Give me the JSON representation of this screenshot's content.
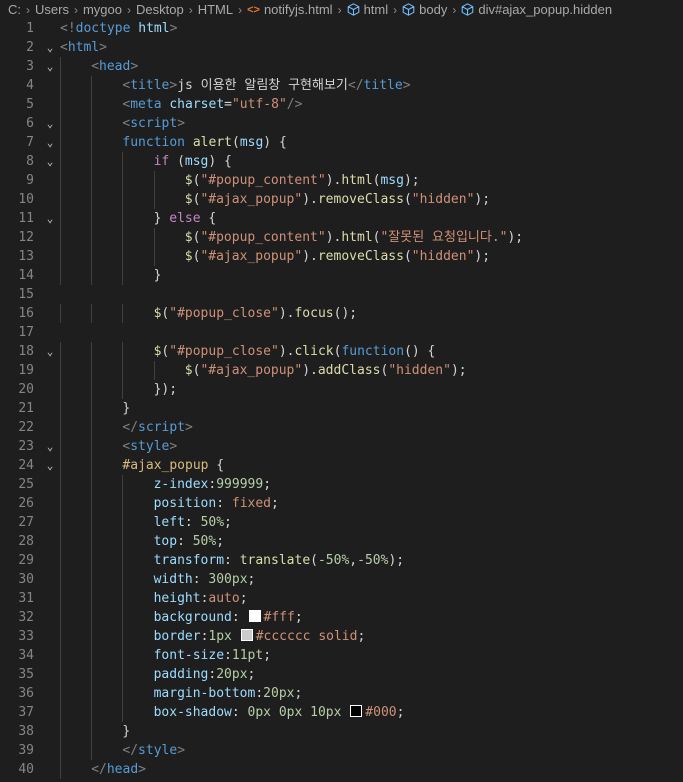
{
  "breadcrumb": [
    {
      "label": "C:",
      "icon": null
    },
    {
      "label": "Users",
      "icon": null
    },
    {
      "label": "mygoo",
      "icon": null
    },
    {
      "label": "Desktop",
      "icon": null
    },
    {
      "label": "HTML",
      "icon": null
    },
    {
      "label": "notifyjs.html",
      "icon": "html-file-icon"
    },
    {
      "label": "html",
      "icon": "element-cube-icon"
    },
    {
      "label": "body",
      "icon": "element-cube-icon"
    },
    {
      "label": "div#ajax_popup.hidden",
      "icon": "element-cube-icon"
    }
  ],
  "colors": {
    "background": "#1e1e1e",
    "line_number": "#858585",
    "tag": "#569cd6",
    "attribute": "#9cdcfe",
    "string": "#ce9178",
    "function": "#dcdcaa",
    "control": "#c586c0",
    "selector": "#d7ba7d",
    "number": "#b5cea8"
  },
  "lines": [
    {
      "n": "1",
      "indent": 0,
      "fold": "",
      "tokens": [
        [
          "punc",
          "<!"
        ],
        [
          "tag",
          "doctype"
        ],
        [
          "txt",
          " "
        ],
        [
          "attr",
          "html"
        ],
        [
          "punc",
          ">"
        ]
      ]
    },
    {
      "n": "2",
      "indent": 0,
      "fold": "v",
      "tokens": [
        [
          "punc",
          "<"
        ],
        [
          "tag",
          "html"
        ],
        [
          "punc",
          ">"
        ]
      ]
    },
    {
      "n": "3",
      "indent": 1,
      "fold": "v",
      "tokens": [
        [
          "punc",
          "<"
        ],
        [
          "tag",
          "head"
        ],
        [
          "punc",
          ">"
        ]
      ]
    },
    {
      "n": "4",
      "indent": 2,
      "fold": "",
      "tokens": [
        [
          "punc",
          "<"
        ],
        [
          "tag",
          "title"
        ],
        [
          "punc",
          ">"
        ],
        [
          "txt",
          "js 이용한 알림창 구현해보기"
        ],
        [
          "punc",
          "</"
        ],
        [
          "tag",
          "title"
        ],
        [
          "punc",
          ">"
        ]
      ]
    },
    {
      "n": "5",
      "indent": 2,
      "fold": "",
      "tokens": [
        [
          "punc",
          "<"
        ],
        [
          "tag",
          "meta"
        ],
        [
          "txt",
          " "
        ],
        [
          "attr",
          "charset"
        ],
        [
          "txt",
          "="
        ],
        [
          "str",
          "\"utf-8\""
        ],
        [
          "punc",
          "/>"
        ]
      ]
    },
    {
      "n": "6",
      "indent": 2,
      "fold": "v",
      "tokens": [
        [
          "punc",
          "<"
        ],
        [
          "tag",
          "script"
        ],
        [
          "punc",
          ">"
        ]
      ]
    },
    {
      "n": "7",
      "indent": 2,
      "fold": "v",
      "tokens": [
        [
          "kw",
          "function"
        ],
        [
          "txt",
          " "
        ],
        [
          "fn",
          "alert"
        ],
        [
          "txt",
          "("
        ],
        [
          "var",
          "msg"
        ],
        [
          "txt",
          ") {"
        ]
      ]
    },
    {
      "n": "8",
      "indent": 3,
      "fold": "v",
      "tokens": [
        [
          "ctl",
          "if"
        ],
        [
          "txt",
          " ("
        ],
        [
          "var",
          "msg"
        ],
        [
          "txt",
          ") {"
        ]
      ]
    },
    {
      "n": "9",
      "indent": 4,
      "fold": "",
      "tokens": [
        [
          "fn",
          "$"
        ],
        [
          "txt",
          "("
        ],
        [
          "str",
          "\"#popup_content\""
        ],
        [
          "txt",
          ")."
        ],
        [
          "fn",
          "html"
        ],
        [
          "txt",
          "("
        ],
        [
          "var",
          "msg"
        ],
        [
          "txt",
          ");"
        ]
      ]
    },
    {
      "n": "10",
      "indent": 4,
      "fold": "",
      "tokens": [
        [
          "fn",
          "$"
        ],
        [
          "txt",
          "("
        ],
        [
          "str",
          "\"#ajax_popup\""
        ],
        [
          "txt",
          ")."
        ],
        [
          "fn",
          "removeClass"
        ],
        [
          "txt",
          "("
        ],
        [
          "str",
          "\"hidden\""
        ],
        [
          "txt",
          ");"
        ]
      ]
    },
    {
      "n": "11",
      "indent": 3,
      "fold": "v",
      "tokens": [
        [
          "txt",
          "} "
        ],
        [
          "ctl",
          "else"
        ],
        [
          "txt",
          " {"
        ]
      ]
    },
    {
      "n": "12",
      "indent": 4,
      "fold": "",
      "tokens": [
        [
          "fn",
          "$"
        ],
        [
          "txt",
          "("
        ],
        [
          "str",
          "\"#popup_content\""
        ],
        [
          "txt",
          ")."
        ],
        [
          "fn",
          "html"
        ],
        [
          "txt",
          "("
        ],
        [
          "str",
          "\"잘못된 요청입니다.\""
        ],
        [
          "txt",
          ");"
        ]
      ]
    },
    {
      "n": "13",
      "indent": 4,
      "fold": "",
      "tokens": [
        [
          "fn",
          "$"
        ],
        [
          "txt",
          "("
        ],
        [
          "str",
          "\"#ajax_popup\""
        ],
        [
          "txt",
          ")."
        ],
        [
          "fn",
          "removeClass"
        ],
        [
          "txt",
          "("
        ],
        [
          "str",
          "\"hidden\""
        ],
        [
          "txt",
          ");"
        ]
      ]
    },
    {
      "n": "14",
      "indent": 3,
      "fold": "",
      "tokens": [
        [
          "txt",
          "}"
        ]
      ]
    },
    {
      "n": "15",
      "indent": 0,
      "fold": "",
      "tokens": []
    },
    {
      "n": "16",
      "indent": 3,
      "fold": "",
      "tokens": [
        [
          "fn",
          "$"
        ],
        [
          "txt",
          "("
        ],
        [
          "str",
          "\"#popup_close\""
        ],
        [
          "txt",
          ")."
        ],
        [
          "fn",
          "focus"
        ],
        [
          "txt",
          "();"
        ]
      ]
    },
    {
      "n": "17",
      "indent": 0,
      "fold": "",
      "tokens": []
    },
    {
      "n": "18",
      "indent": 3,
      "fold": "v",
      "tokens": [
        [
          "fn",
          "$"
        ],
        [
          "txt",
          "("
        ],
        [
          "str",
          "\"#popup_close\""
        ],
        [
          "txt",
          ")."
        ],
        [
          "fn",
          "click"
        ],
        [
          "txt",
          "("
        ],
        [
          "kw",
          "function"
        ],
        [
          "txt",
          "() {"
        ]
      ]
    },
    {
      "n": "19",
      "indent": 4,
      "fold": "",
      "tokens": [
        [
          "fn",
          "$"
        ],
        [
          "txt",
          "("
        ],
        [
          "str",
          "\"#ajax_popup\""
        ],
        [
          "txt",
          ")."
        ],
        [
          "fn",
          "addClass"
        ],
        [
          "txt",
          "("
        ],
        [
          "str",
          "\"hidden\""
        ],
        [
          "txt",
          ");"
        ]
      ]
    },
    {
      "n": "20",
      "indent": 3,
      "fold": "",
      "tokens": [
        [
          "txt",
          "});"
        ]
      ]
    },
    {
      "n": "21",
      "indent": 2,
      "fold": "",
      "tokens": [
        [
          "txt",
          "}"
        ]
      ]
    },
    {
      "n": "22",
      "indent": 2,
      "fold": "",
      "tokens": [
        [
          "punc",
          "</"
        ],
        [
          "tag",
          "script"
        ],
        [
          "punc",
          ">"
        ]
      ]
    },
    {
      "n": "23",
      "indent": 2,
      "fold": "v",
      "tokens": [
        [
          "punc",
          "<"
        ],
        [
          "tag",
          "style"
        ],
        [
          "punc",
          ">"
        ]
      ]
    },
    {
      "n": "24",
      "indent": 2,
      "fold": "v",
      "tokens": [
        [
          "sel",
          "#ajax_popup"
        ],
        [
          "txt",
          " {"
        ]
      ]
    },
    {
      "n": "25",
      "indent": 3,
      "fold": "",
      "tokens": [
        [
          "prop",
          "z-index"
        ],
        [
          "txt",
          ":"
        ],
        [
          "num",
          "999999"
        ],
        [
          "txt",
          ";"
        ]
      ]
    },
    {
      "n": "26",
      "indent": 3,
      "fold": "",
      "tokens": [
        [
          "prop",
          "position"
        ],
        [
          "txt",
          ": "
        ],
        [
          "val",
          "fixed"
        ],
        [
          "txt",
          ";"
        ]
      ]
    },
    {
      "n": "27",
      "indent": 3,
      "fold": "",
      "tokens": [
        [
          "prop",
          "left"
        ],
        [
          "txt",
          ": "
        ],
        [
          "num",
          "50%"
        ],
        [
          "txt",
          ";"
        ]
      ]
    },
    {
      "n": "28",
      "indent": 3,
      "fold": "",
      "tokens": [
        [
          "prop",
          "top"
        ],
        [
          "txt",
          ": "
        ],
        [
          "num",
          "50%"
        ],
        [
          "txt",
          ";"
        ]
      ]
    },
    {
      "n": "29",
      "indent": 3,
      "fold": "",
      "tokens": [
        [
          "prop",
          "transform"
        ],
        [
          "txt",
          ": "
        ],
        [
          "fn",
          "translate"
        ],
        [
          "txt",
          "("
        ],
        [
          "num",
          "-50%"
        ],
        [
          "txt",
          ","
        ],
        [
          "num",
          "-50%"
        ],
        [
          "txt",
          ");"
        ]
      ]
    },
    {
      "n": "30",
      "indent": 3,
      "fold": "",
      "tokens": [
        [
          "prop",
          "width"
        ],
        [
          "txt",
          ": "
        ],
        [
          "num",
          "300px"
        ],
        [
          "txt",
          ";"
        ]
      ]
    },
    {
      "n": "31",
      "indent": 3,
      "fold": "",
      "tokens": [
        [
          "prop",
          "height"
        ],
        [
          "txt",
          ":"
        ],
        [
          "val",
          "auto"
        ],
        [
          "txt",
          ";"
        ]
      ]
    },
    {
      "n": "32",
      "indent": 3,
      "fold": "",
      "tokens": [
        [
          "prop",
          "background"
        ],
        [
          "txt",
          ": "
        ],
        [
          "swatch",
          "#ffffff"
        ],
        [
          "val",
          "#fff"
        ],
        [
          "txt",
          ";"
        ]
      ]
    },
    {
      "n": "33",
      "indent": 3,
      "fold": "",
      "tokens": [
        [
          "prop",
          "border"
        ],
        [
          "txt",
          ":"
        ],
        [
          "num",
          "1px"
        ],
        [
          "txt",
          " "
        ],
        [
          "swatch",
          "#cccccc"
        ],
        [
          "val",
          "#cccccc"
        ],
        [
          "txt",
          " "
        ],
        [
          "val",
          "solid"
        ],
        [
          "txt",
          ";"
        ]
      ]
    },
    {
      "n": "34",
      "indent": 3,
      "fold": "",
      "tokens": [
        [
          "prop",
          "font-size"
        ],
        [
          "txt",
          ":"
        ],
        [
          "num",
          "11pt"
        ],
        [
          "txt",
          ";"
        ]
      ]
    },
    {
      "n": "35",
      "indent": 3,
      "fold": "",
      "tokens": [
        [
          "prop",
          "padding"
        ],
        [
          "txt",
          ":"
        ],
        [
          "num",
          "20px"
        ],
        [
          "txt",
          ";"
        ]
      ]
    },
    {
      "n": "36",
      "indent": 3,
      "fold": "",
      "tokens": [
        [
          "prop",
          "margin-bottom"
        ],
        [
          "txt",
          ":"
        ],
        [
          "num",
          "20px"
        ],
        [
          "txt",
          ";"
        ]
      ]
    },
    {
      "n": "37",
      "indent": 3,
      "fold": "",
      "tokens": [
        [
          "prop",
          "box-shadow"
        ],
        [
          "txt",
          ": "
        ],
        [
          "num",
          "0px"
        ],
        [
          "txt",
          " "
        ],
        [
          "num",
          "0px"
        ],
        [
          "txt",
          " "
        ],
        [
          "num",
          "10px"
        ],
        [
          "txt",
          " "
        ],
        [
          "swatch",
          "#000000"
        ],
        [
          "val",
          "#000"
        ],
        [
          "txt",
          ";"
        ]
      ]
    },
    {
      "n": "38",
      "indent": 2,
      "fold": "",
      "tokens": [
        [
          "txt",
          "}"
        ]
      ]
    },
    {
      "n": "39",
      "indent": 2,
      "fold": "",
      "tokens": [
        [
          "punc",
          "</"
        ],
        [
          "tag",
          "style"
        ],
        [
          "punc",
          ">"
        ]
      ]
    },
    {
      "n": "40",
      "indent": 1,
      "fold": "",
      "tokens": [
        [
          "punc",
          "</"
        ],
        [
          "tag",
          "head"
        ],
        [
          "punc",
          ">"
        ]
      ]
    }
  ]
}
